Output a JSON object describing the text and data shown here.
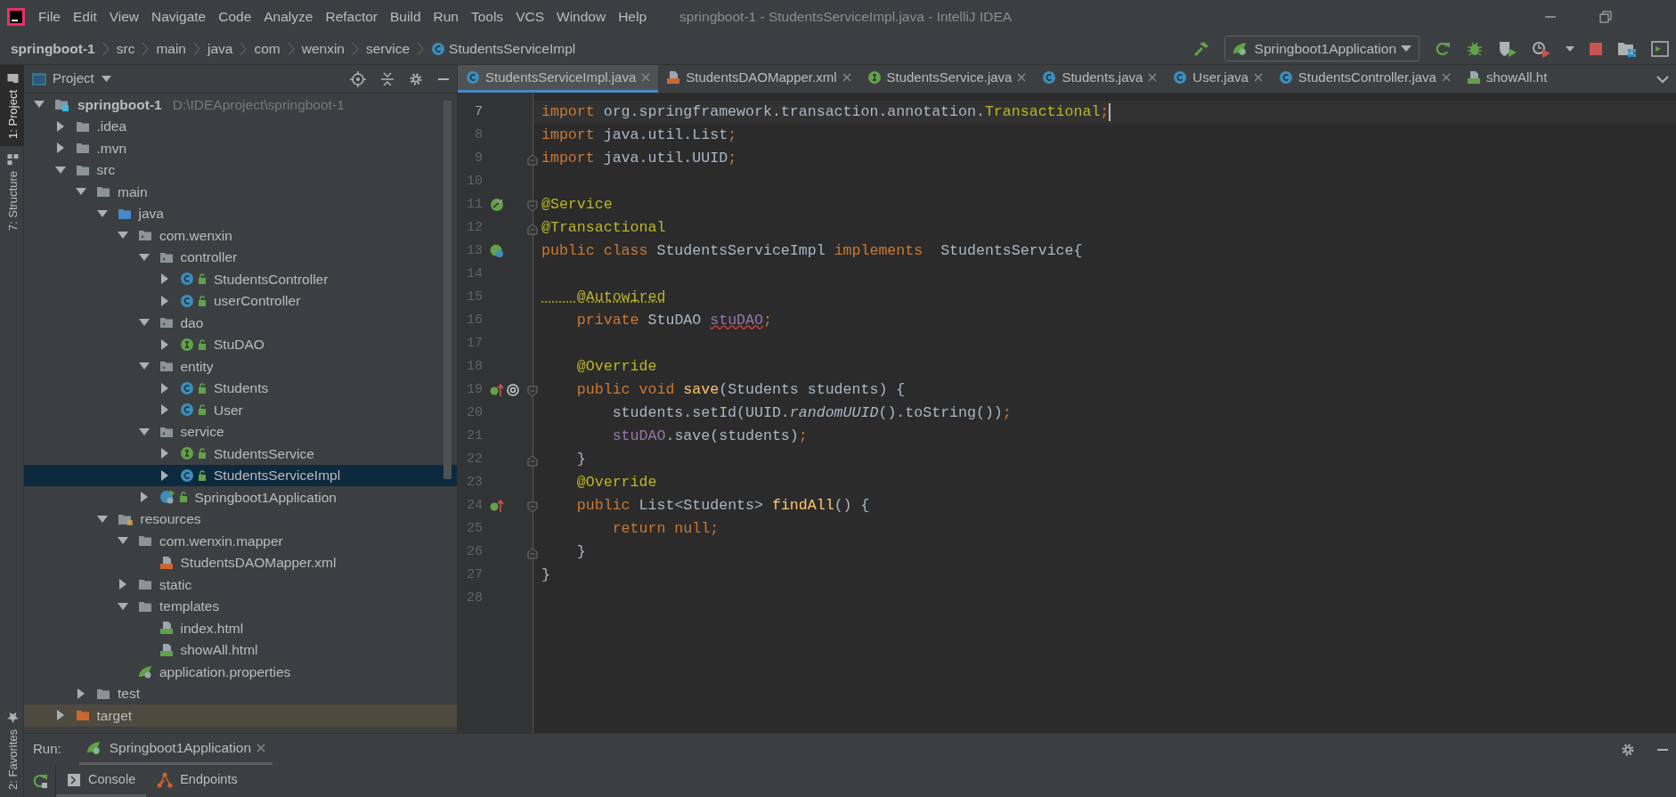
{
  "window": {
    "title": "springboot-1 - StudentsServiceImpl.java - IntelliJ IDEA"
  },
  "menu": [
    "File",
    "Edit",
    "View",
    "Navigate",
    "Code",
    "Analyze",
    "Refactor",
    "Build",
    "Run",
    "Tools",
    "VCS",
    "Window",
    "Help"
  ],
  "breadcrumbs": [
    {
      "label": "springboot-1",
      "kind": "project"
    },
    {
      "label": "src",
      "kind": "dir"
    },
    {
      "label": "main",
      "kind": "dir"
    },
    {
      "label": "java",
      "kind": "dir"
    },
    {
      "label": "com",
      "kind": "dir"
    },
    {
      "label": "wenxin",
      "kind": "dir"
    },
    {
      "label": "service",
      "kind": "dir"
    },
    {
      "label": "StudentsServiceImpl",
      "kind": "class"
    }
  ],
  "run_config": {
    "label": "Springboot1Application"
  },
  "tool_stripe": {
    "top": [
      {
        "label": "1: Project",
        "selected": true
      },
      {
        "label": "7: Structure",
        "selected": false
      }
    ],
    "bottom": [
      {
        "label": "2: Favorites",
        "selected": false
      }
    ]
  },
  "project_panel": {
    "title": "Project",
    "tree": [
      {
        "label": "springboot-1",
        "hint": "D:\\IDEAproject\\springboot-1",
        "kind": "module",
        "expanded": true,
        "selected": false,
        "children": [
          {
            "label": ".idea",
            "kind": "folder",
            "expanded": false,
            "selected": false
          },
          {
            "label": ".mvn",
            "kind": "folder",
            "expanded": false,
            "selected": false
          },
          {
            "label": "src",
            "kind": "folder",
            "expanded": true,
            "selected": false,
            "children": [
              {
                "label": "main",
                "kind": "folder",
                "expanded": true,
                "selected": false,
                "children": [
                  {
                    "label": "java",
                    "kind": "source-root",
                    "expanded": true,
                    "selected": false,
                    "children": [
                      {
                        "label": "com.wenxin",
                        "kind": "package",
                        "expanded": true,
                        "selected": false,
                        "children": [
                          {
                            "label": "controller",
                            "kind": "package",
                            "expanded": true,
                            "selected": false,
                            "children": [
                              {
                                "label": "StudentsController",
                                "kind": "class",
                                "expanded": false,
                                "selected": false
                              },
                              {
                                "label": "userController",
                                "kind": "class",
                                "expanded": false,
                                "selected": false
                              }
                            ]
                          },
                          {
                            "label": "dao",
                            "kind": "package",
                            "expanded": true,
                            "selected": false,
                            "children": [
                              {
                                "label": "StuDAO",
                                "kind": "interface",
                                "expanded": false,
                                "selected": false
                              }
                            ]
                          },
                          {
                            "label": "entity",
                            "kind": "package",
                            "expanded": true,
                            "selected": false,
                            "children": [
                              {
                                "label": "Students",
                                "kind": "class",
                                "expanded": false,
                                "selected": false
                              },
                              {
                                "label": "User",
                                "kind": "class",
                                "expanded": false,
                                "selected": false
                              }
                            ]
                          },
                          {
                            "label": "service",
                            "kind": "package",
                            "expanded": true,
                            "selected": false,
                            "children": [
                              {
                                "label": "StudentsService",
                                "kind": "interface",
                                "expanded": false,
                                "selected": false
                              },
                              {
                                "label": "StudentsServiceImpl",
                                "kind": "class",
                                "expanded": false,
                                "selected": true
                              }
                            ]
                          },
                          {
                            "label": "Springboot1Application",
                            "kind": "spring-app",
                            "expanded": false,
                            "selected": false
                          }
                        ]
                      }
                    ]
                  },
                  {
                    "label": "resources",
                    "kind": "resources-root",
                    "expanded": true,
                    "selected": false,
                    "children": [
                      {
                        "label": "com.wenxin.mapper",
                        "kind": "folder",
                        "expanded": true,
                        "selected": false,
                        "children": [
                          {
                            "label": "StudentsDAOMapper.xml",
                            "kind": "xml",
                            "selected": false
                          }
                        ]
                      },
                      {
                        "label": "static",
                        "kind": "folder",
                        "expanded": false,
                        "selected": false
                      },
                      {
                        "label": "templates",
                        "kind": "folder",
                        "expanded": true,
                        "selected": false,
                        "children": [
                          {
                            "label": "index.html",
                            "kind": "html",
                            "selected": false
                          },
                          {
                            "label": "showAll.html",
                            "kind": "html",
                            "selected": false
                          }
                        ]
                      },
                      {
                        "label": "application.properties",
                        "kind": "spring-config",
                        "selected": false
                      }
                    ]
                  }
                ]
              },
              {
                "label": "test",
                "kind": "folder",
                "expanded": false,
                "selected": false
              }
            ]
          },
          {
            "label": "target",
            "kind": "excluded-folder",
            "expanded": false,
            "selected": false
          }
        ]
      }
    ]
  },
  "editor": {
    "tabs": [
      {
        "label": "StudentsServiceImpl.java",
        "kind": "class",
        "selected": true,
        "closable": true
      },
      {
        "label": "StudentsDAOMapper.xml",
        "kind": "xml",
        "selected": false,
        "closable": true
      },
      {
        "label": "StudentsService.java",
        "kind": "interface",
        "selected": false,
        "closable": true
      },
      {
        "label": "Students.java",
        "kind": "class",
        "selected": false,
        "closable": true
      },
      {
        "label": "User.java",
        "kind": "class",
        "selected": false,
        "closable": true
      },
      {
        "label": "StudentsController.java",
        "kind": "class",
        "selected": false,
        "closable": true
      },
      {
        "label": "showAll.ht",
        "kind": "html",
        "selected": false,
        "closable": false
      }
    ],
    "lines": [
      {
        "number": "7",
        "current": true,
        "tokens": [
          {
            "text": "import",
            "kind": "keyword"
          },
          {
            "text": " org.springframework.transaction.annotation.",
            "kind": "plain"
          },
          {
            "text": "Transactional",
            "kind": "annotation"
          },
          {
            "text": ";",
            "kind": "keyword"
          }
        ]
      },
      {
        "number": "8",
        "current": false,
        "tokens": [
          {
            "text": "import",
            "kind": "keyword"
          },
          {
            "text": " java.util.List",
            "kind": "plain"
          },
          {
            "text": ";",
            "kind": "keyword"
          }
        ]
      },
      {
        "number": "9",
        "current": false,
        "fold": {
          "kind": "end"
        },
        "tokens": [
          {
            "text": "import",
            "kind": "keyword"
          },
          {
            "text": " java.util.UUID",
            "kind": "plain"
          },
          {
            "text": ";",
            "kind": "keyword"
          }
        ]
      },
      {
        "number": "10",
        "current": false
      },
      {
        "number": "11",
        "current": false,
        "fold": {
          "kind": "start"
        },
        "gutter": [
          {
            "kind": "spring-bean"
          }
        ],
        "tokens": [
          {
            "text": "@Service",
            "kind": "annotation"
          }
        ]
      },
      {
        "number": "12",
        "current": false,
        "fold": {
          "kind": "end"
        },
        "tokens": [
          {
            "text": "@Transactional",
            "kind": "annotation"
          }
        ]
      },
      {
        "number": "13",
        "current": false,
        "gutter": [
          {
            "kind": "spring-class"
          }
        ],
        "tokens": [
          {
            "text": "public class",
            "kind": "keyword"
          },
          {
            "text": " StudentsServiceImpl ",
            "kind": "plain"
          },
          {
            "text": "implements",
            "kind": "keyword"
          },
          {
            "text": "  StudentsService{",
            "kind": "plain"
          }
        ]
      },
      {
        "number": "14",
        "current": false
      },
      {
        "number": "15",
        "current": false,
        "tokens": [
          {
            "text": "    @Autowired",
            "kind": "annotation-warning"
          }
        ]
      },
      {
        "number": "16",
        "current": false,
        "tokens": [
          {
            "text": "    private",
            "kind": "keyword"
          },
          {
            "text": " StuDAO ",
            "kind": "plain"
          },
          {
            "text": "stuDAO",
            "kind": "field-error"
          },
          {
            "text": ";",
            "kind": "keyword"
          }
        ]
      },
      {
        "number": "17",
        "current": false
      },
      {
        "number": "18",
        "current": false,
        "tokens": [
          {
            "text": "    @Override",
            "kind": "annotation"
          }
        ]
      },
      {
        "number": "19",
        "current": false,
        "fold": {
          "kind": "start"
        },
        "gutter": [
          {
            "kind": "implements"
          },
          {
            "kind": "autowired"
          }
        ],
        "tokens": [
          {
            "text": "    public void ",
            "kind": "keyword"
          },
          {
            "text": "save",
            "kind": "method"
          },
          {
            "text": "(Students students) {",
            "kind": "plain"
          }
        ]
      },
      {
        "number": "20",
        "current": false,
        "tokens": [
          {
            "text": "        students.setId(UUID.",
            "kind": "plain"
          },
          {
            "text": "randomUUID",
            "kind": "static-call"
          },
          {
            "text": "().toString())",
            "kind": "plain"
          },
          {
            "text": ";",
            "kind": "keyword"
          }
        ]
      },
      {
        "number": "21",
        "current": false,
        "tokens": [
          {
            "text": "        stuDAO",
            "kind": "field"
          },
          {
            "text": ".save(students)",
            "kind": "plain"
          },
          {
            "text": ";",
            "kind": "keyword"
          }
        ]
      },
      {
        "number": "22",
        "current": false,
        "fold": {
          "kind": "end"
        },
        "tokens": [
          {
            "text": "    }",
            "kind": "plain"
          }
        ]
      },
      {
        "number": "23",
        "current": false,
        "tokens": [
          {
            "text": "    @Override",
            "kind": "annotation"
          }
        ]
      },
      {
        "number": "24",
        "current": false,
        "fold": {
          "kind": "start"
        },
        "gutter": [
          {
            "kind": "implements"
          }
        ],
        "tokens": [
          {
            "text": "    public",
            "kind": "keyword"
          },
          {
            "text": " List<Students> ",
            "kind": "plain"
          },
          {
            "text": "findAll",
            "kind": "method"
          },
          {
            "text": "() {",
            "kind": "plain"
          }
        ]
      },
      {
        "number": "25",
        "current": false,
        "tokens": [
          {
            "text": "        return null;",
            "kind": "keyword"
          }
        ]
      },
      {
        "number": "26",
        "current": false,
        "fold": {
          "kind": "end"
        },
        "tokens": [
          {
            "text": "    }",
            "kind": "plain"
          }
        ]
      },
      {
        "number": "27",
        "current": false,
        "tokens": [
          {
            "text": "}",
            "kind": "plain"
          }
        ]
      },
      {
        "number": "28",
        "current": false
      }
    ]
  },
  "run_panel": {
    "label": "Run:",
    "tabs": [
      {
        "label": "Springboot1Application",
        "selected": true
      }
    ],
    "subtabs": [
      {
        "label": "Console",
        "kind": "console",
        "selected": true
      },
      {
        "label": "Endpoints",
        "kind": "endpoints",
        "selected": false
      }
    ]
  }
}
